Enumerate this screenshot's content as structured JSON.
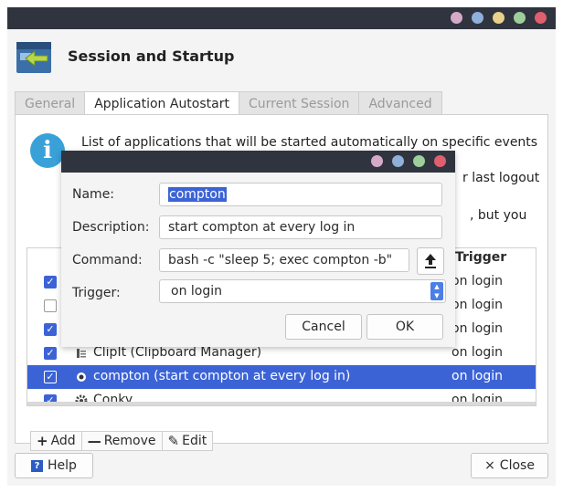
{
  "colors": {
    "titlebar": "#2f343f",
    "accent": "#3c63d6",
    "info": "#3aa0d8",
    "dot_colors": [
      "#d7a9c9",
      "#8fb0d8",
      "#e8d18a",
      "#9dcf9a",
      "#e05f6f"
    ]
  },
  "window": {
    "title": "Session and Startup",
    "icon": "session-startup-icon"
  },
  "tabs": [
    {
      "label": "General",
      "active": false
    },
    {
      "label": "Application Autostart",
      "active": true
    },
    {
      "label": "Current Session",
      "active": false
    },
    {
      "label": "Advanced",
      "active": false
    }
  ],
  "info": {
    "icon": "info-icon",
    "line1": "List of applications that will be started automatically on specific events",
    "line2": "r last logout",
    "line3": ", but you"
  },
  "list": {
    "header_trigger": "Trigger",
    "rows": [
      {
        "checked": true,
        "icon": "",
        "label": "",
        "trigger": "on login",
        "selected": false
      },
      {
        "checked": false,
        "icon": "",
        "label": "",
        "trigger": "on login",
        "selected": false
      },
      {
        "checked": true,
        "icon": "",
        "label": "",
        "trigger": "on login",
        "selected": false
      },
      {
        "checked": true,
        "icon": "clipboard-icon",
        "label": "ClipIt (Clipboard Manager)",
        "trigger": "on login",
        "selected": false
      },
      {
        "checked": true,
        "icon": "app-dot-icon",
        "label": "compton (start compton at every log in)",
        "trigger": "on login",
        "selected": true
      },
      {
        "checked": true,
        "icon": "gear-icon",
        "label": "Conky",
        "trigger": "on login",
        "selected": false
      }
    ]
  },
  "toolbar": {
    "add_label": "Add",
    "remove_label": "Remove",
    "edit_label": "Edit"
  },
  "footer": {
    "help_label": "Help",
    "close_label": "Close"
  },
  "dialog": {
    "name_label": "Name:",
    "name_value": "compton",
    "description_label": "Description:",
    "description_value": "start compton at every log in",
    "command_label": "Command:",
    "command_value": "bash -c \"sleep 5; exec compton -b\"",
    "trigger_label": "Trigger:",
    "trigger_value": "on login",
    "cancel_label": "Cancel",
    "ok_label": "OK"
  }
}
